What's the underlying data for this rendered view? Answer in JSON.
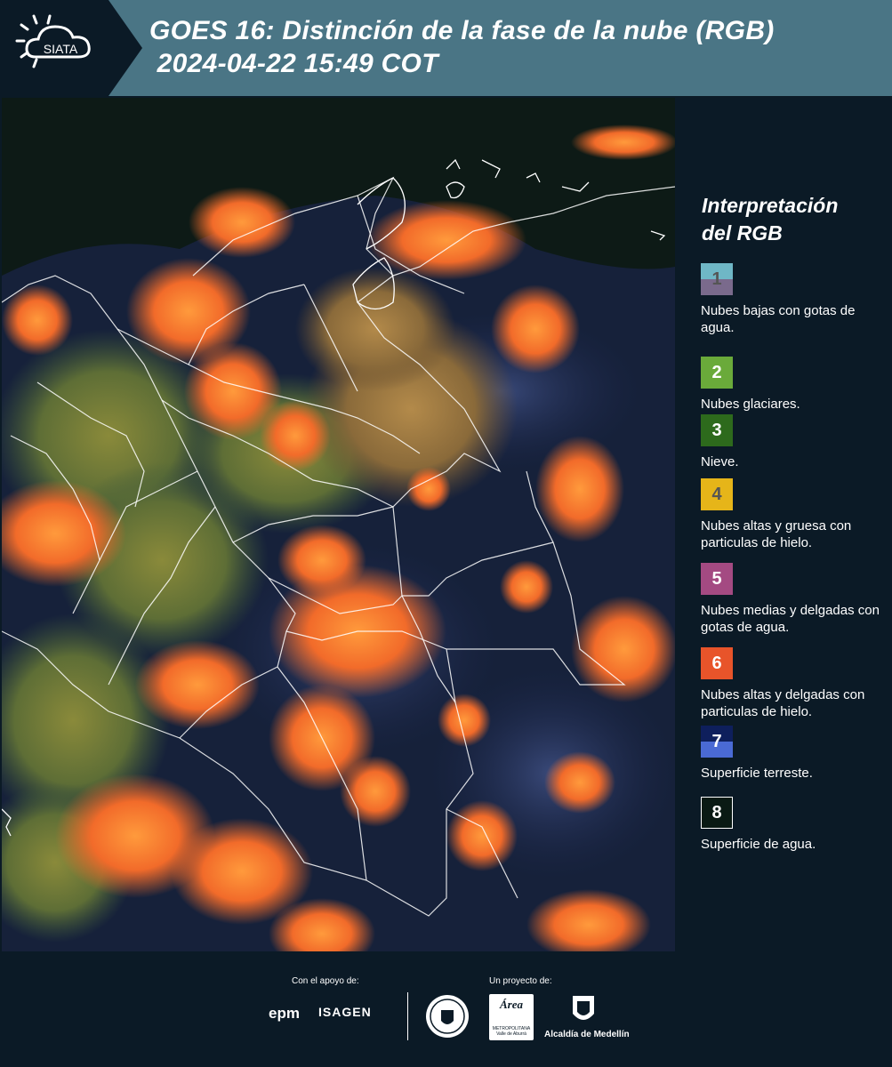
{
  "header": {
    "logo_text": "SIATA",
    "title_line1": "GOES 16: Distinción de la fase de la nube (RGB)",
    "title_line2": " 2024-04-22 15:49 COT"
  },
  "legend": {
    "title_line1": "Interpretación",
    "title_line2": "del RGB",
    "items": [
      {
        "number": "1",
        "label": "Nubes bajas con gotas de agua.",
        "color_top": "#6fb7c6",
        "color_bottom": "#7a6a8c",
        "text_color": "#555555"
      },
      {
        "number": "2",
        "label": "Nubes glaciares.",
        "color_top": "#6aaa3a",
        "color_bottom": "#6aaa3a",
        "text_color": "#ffffff"
      },
      {
        "number": "3",
        "label": "Nieve.",
        "color_top": "#2d6a1c",
        "color_bottom": "#2d6a1c",
        "text_color": "#ffffff"
      },
      {
        "number": "4",
        "label": "Nubes altas y gruesa con particulas de hielo.",
        "color_top": "#e6b519",
        "color_bottom": "#e6b519",
        "text_color": "#555555"
      },
      {
        "number": "5",
        "label": "Nubes medias y delgadas con gotas de agua.",
        "color_top": "#a44a82",
        "color_bottom": "#a44a82",
        "text_color": "#ffffff"
      },
      {
        "number": "6",
        "label": "Nubes altas y delgadas con particulas de hielo.",
        "color_top": "#e8542a",
        "color_bottom": "#e8542a",
        "text_color": "#ffffff"
      },
      {
        "number": "7",
        "label": "Superficie terreste.",
        "color_top": "#0e1f5c",
        "color_bottom": "#4a6ad4",
        "text_color": "#ffffff"
      },
      {
        "number": "8",
        "label": "Superficie de agua.",
        "color_top": "#0a1a14",
        "color_bottom": "#0a1a14",
        "text_color": "#ffffff"
      }
    ]
  },
  "footer": {
    "support_label": "Con el apoyo de:",
    "project_label": "Un proyecto de:",
    "epm": "epm",
    "isagen": "ISAGEN",
    "area_text": "Área",
    "area_sub": "METROPOLITANA Valle de Aburrá",
    "alcaldia": "Alcaldía de Medellín"
  }
}
